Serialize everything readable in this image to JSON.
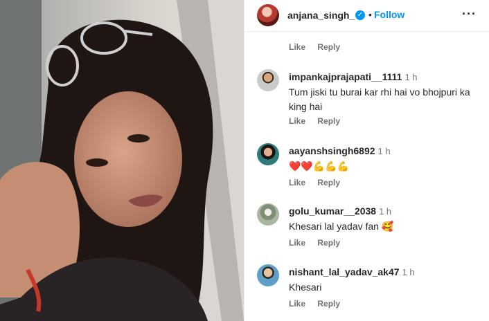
{
  "post": {
    "photo_alt_icon": "portrait-photo",
    "author": "anjana_singh_",
    "follow_label": "Follow",
    "separator": "•",
    "more_icon": "more-options-icon",
    "more_glyph": "···",
    "verified_glyph": "✓"
  },
  "first_actions": {
    "like": "Like",
    "reply": "Reply"
  },
  "comments": [
    {
      "user": "impankajprajapati__1111",
      "time": "1 h",
      "text": "Tum jiski tu burai kar rhi hai vo bhojpuri ka king hai",
      "like": "Like",
      "reply": "Reply"
    },
    {
      "user": "aayanshsingh6892",
      "time": "1 h",
      "text": "❤️❤️💪💪💪",
      "like": "Like",
      "reply": "Reply"
    },
    {
      "user": "golu_kumar__2038",
      "time": "1 h",
      "text": "Khesari lal yadav fan 🥰",
      "like": "Like",
      "reply": "Reply"
    },
    {
      "user": "nishant_lal_yadav_ak47",
      "time": "1 h",
      "text": "Khesari",
      "like": "Like",
      "reply": "Reply"
    }
  ],
  "colors": {
    "accent": "#0095f6",
    "muted": "#737373",
    "text": "#262626"
  }
}
